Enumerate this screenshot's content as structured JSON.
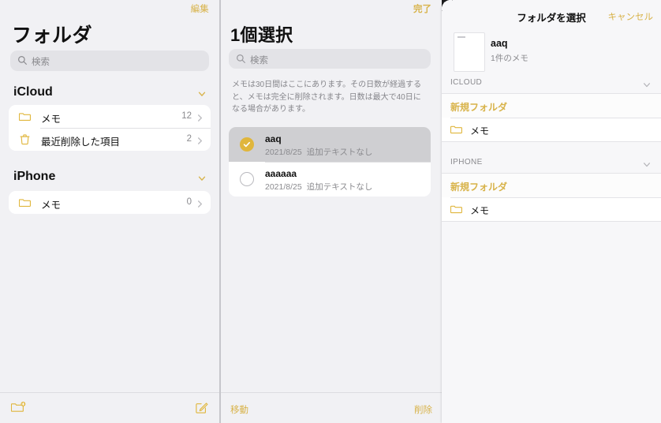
{
  "colors": {
    "accent": "#d8b34a",
    "folder_icon": "#e0b63c",
    "page_bg": "#f1f1f4",
    "card_bg": "#ffffff",
    "selected_row": "#cfcfd2",
    "secondary_text": "#8a8a8e"
  },
  "folders_panel": {
    "edit_label": "編集",
    "title": "フォルダ",
    "search": {
      "placeholder": "検索",
      "value": "",
      "icon": "search-icon"
    },
    "sections": [
      {
        "name": "iCloud",
        "chevron": "chevron-down-icon",
        "rows": [
          {
            "icon": "folder-icon",
            "label": "メモ",
            "count": "12",
            "chevron": "chevron-right-icon"
          },
          {
            "icon": "trash-icon",
            "label": "最近削除した項目",
            "count": "2",
            "chevron": "chevron-right-icon"
          }
        ]
      },
      {
        "name": "iPhone",
        "chevron": "chevron-down-icon",
        "rows": [
          {
            "icon": "folder-icon",
            "label": "メモ",
            "count": "0",
            "chevron": "chevron-right-icon"
          }
        ]
      }
    ],
    "toolbar": {
      "new_folder_icon": "new-folder-icon",
      "compose_icon": "compose-icon"
    }
  },
  "notes_panel": {
    "done_label": "完了",
    "title": "1個選択",
    "search": {
      "placeholder": "検索",
      "value": "",
      "icon": "search-icon"
    },
    "description": "メモは30日間はここにあります。その日数が経過すると、メモは完全に削除されます。日数は最大で40日になる場合があります。",
    "notes": [
      {
        "selected": true,
        "checkbox_icon": "checkmark-circle-filled-icon",
        "title": "aaq",
        "date": "2021/8/25",
        "preview": "追加テキストなし"
      },
      {
        "selected": false,
        "checkbox_icon": "circle-outline-icon",
        "title": "aaaaaa",
        "date": "2021/8/25",
        "preview": "追加テキストなし"
      }
    ],
    "toolbar": {
      "move_label": "移動",
      "delete_label": "削除"
    }
  },
  "folder_picker_sheet": {
    "nav_title": "フォルダを選択",
    "cancel_label": "キャンセル",
    "preview": {
      "thumbnail_icon": "note-thumbnail-icon",
      "name": "aaq",
      "count": "1件のメモ"
    },
    "groups": [
      {
        "header": "ICLOUD",
        "chevron": "chevron-down-icon",
        "rows": [
          {
            "type": "new-folder",
            "label": "新規フォルダ"
          },
          {
            "type": "folder",
            "icon": "folder-icon",
            "label": "メモ"
          }
        ]
      },
      {
        "header": "IPHONE",
        "chevron": "chevron-down-icon",
        "rows": [
          {
            "type": "new-folder",
            "label": "新規フォルダ"
          },
          {
            "type": "folder",
            "icon": "folder-icon",
            "label": "メモ"
          }
        ]
      }
    ]
  }
}
